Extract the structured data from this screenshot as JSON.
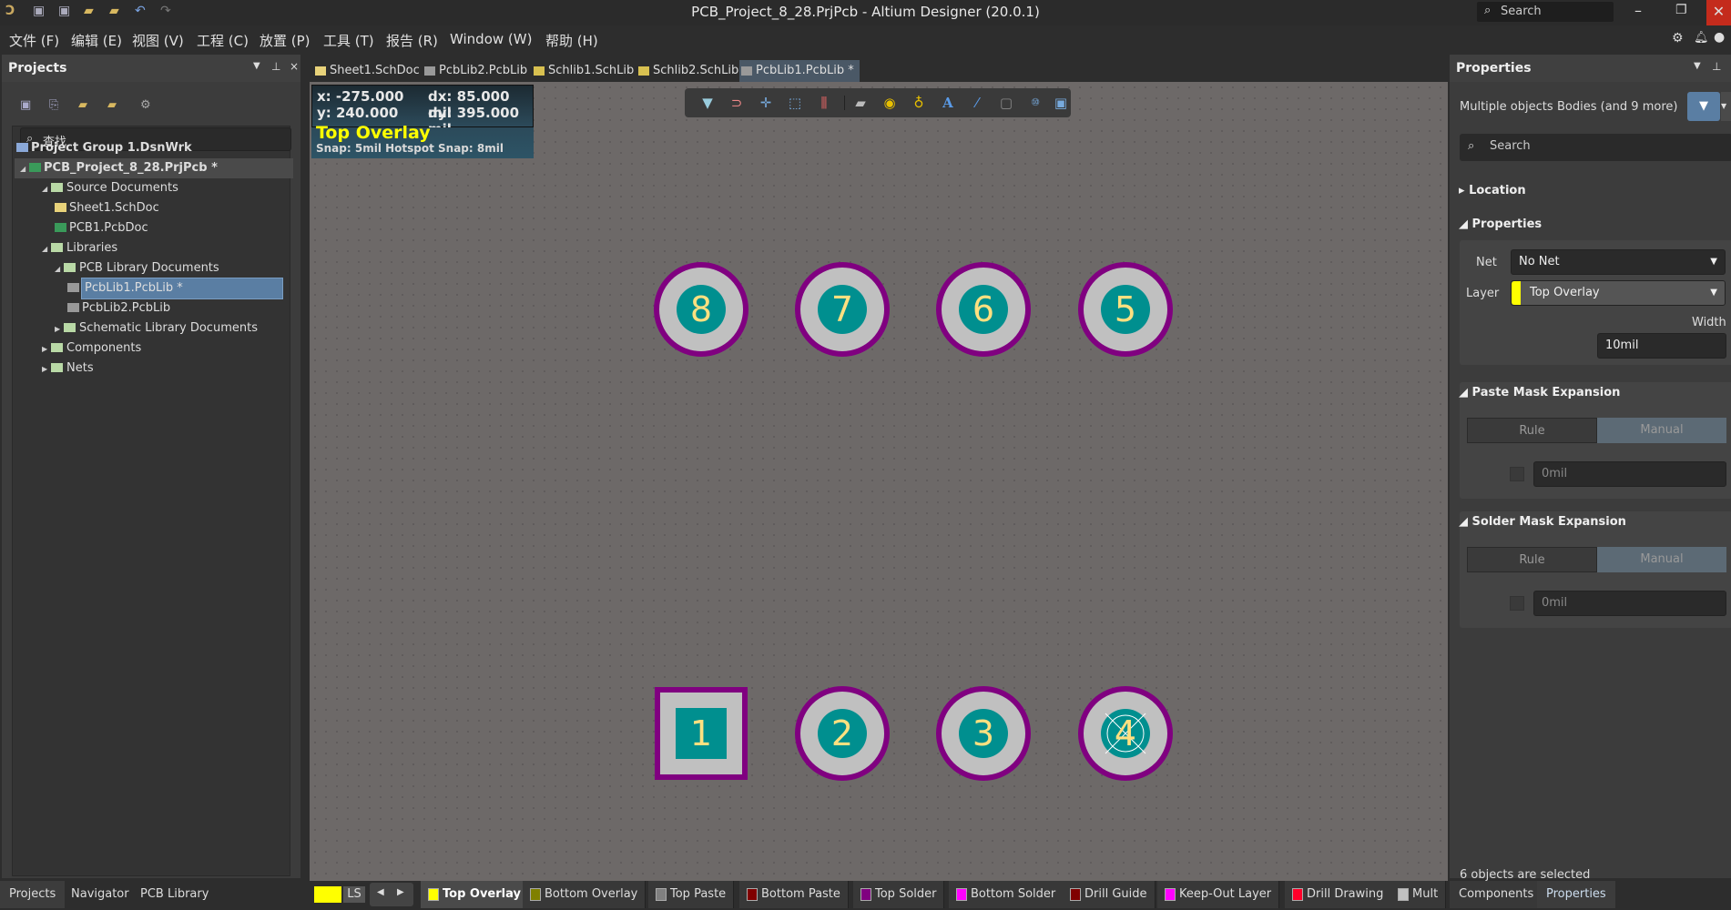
{
  "window": {
    "title": "PCB_Project_8_28.PrjPcb - Altium Designer (20.0.1)",
    "search_placeholder": "Search"
  },
  "menu": [
    "文件 (F)",
    "编辑 (E)",
    "视图 (V)",
    "工程 (C)",
    "放置 (P)",
    "工具 (T)",
    "报告 (R)",
    "Window (W)",
    "帮助 (H)"
  ],
  "projects_panel": {
    "title": "Projects",
    "search_placeholder": "查找",
    "tree": [
      {
        "label": "Project Group 1.DsnWrk",
        "level": 0,
        "bold": true
      },
      {
        "label": "PCB_Project_8_28.PrjPcb *",
        "level": 0,
        "bold": true
      },
      {
        "label": "Source Documents",
        "level": 1
      },
      {
        "label": "Sheet1.SchDoc",
        "level": 2
      },
      {
        "label": "PCB1.PcbDoc",
        "level": 2
      },
      {
        "label": "Libraries",
        "level": 1
      },
      {
        "label": "PCB Library Documents",
        "level": 2
      },
      {
        "label": "PcbLib1.PcbLib *",
        "level": 3,
        "selected": true
      },
      {
        "label": "PcbLib2.PcbLib",
        "level": 3
      },
      {
        "label": "Schematic Library Documents",
        "level": 2
      },
      {
        "label": "Components",
        "level": 1
      },
      {
        "label": "Nets",
        "level": 1
      }
    ],
    "bottom_tabs": [
      "Projects",
      "Navigator",
      "PCB Library"
    ]
  },
  "doc_tabs": [
    "Sheet1.SchDoc",
    "PcbLib2.PcbLib",
    "Schlib1.SchLib",
    "Schlib2.SchLib",
    "PcbLib1.PcbLib *"
  ],
  "hud": {
    "x": "x:  -275.000",
    "dx": "dx:    85.000  mil",
    "y": "y:   240.000",
    "dy": "dy:  395.000 mil",
    "layer": "Top Overlay",
    "snap": "Snap: 5mil Hotspot Snap: 8mil"
  },
  "toolbar_icons": [
    "filter-icon",
    "magnet-icon",
    "crosshair-icon",
    "select-rect-icon",
    "align-icon",
    "component-icon",
    "pad-icon",
    "via-icon",
    "text-icon",
    "line-icon",
    "dimension-icon",
    "region-icon",
    "room-icon"
  ],
  "pads": {
    "top": [
      "8",
      "7",
      "6",
      "5"
    ],
    "bottom": [
      "1",
      "2",
      "3",
      "4"
    ]
  },
  "colors": {
    "pad_copper": "#008f8f",
    "pad_mask": "#c0c0c0",
    "solder_mask": "#800080",
    "number": "#ffe080",
    "canvas": "#6d6968",
    "accent": "#5a7ea3"
  },
  "properties_panel": {
    "title": "Properties",
    "selection": "Multiple objects",
    "filter_text": "Bodies (and 9 more)",
    "search_placeholder": "Search",
    "location": "Location",
    "properties": "Properties",
    "net_label": "Net",
    "net_value": "No Net",
    "layer_label": "Layer",
    "layer_value": "Top Overlay",
    "width_label": "Width",
    "width_value": "10mil",
    "paste_mask": "Paste Mask Expansion",
    "solder_mask": "Solder Mask Expansion",
    "rule": "Rule",
    "manual": "Manual",
    "paste_value": "0mil",
    "solder_value": "0mil",
    "status": "6 objects are selected",
    "bottom_tabs": [
      "Components",
      "Properties"
    ]
  },
  "layer_bar": {
    "current": "LS",
    "layers": [
      {
        "name": "Top Overlay",
        "color": "#ffff00"
      },
      {
        "name": "Bottom Overlay",
        "color": "#808000"
      },
      {
        "name": "Top Paste",
        "color": "#808080"
      },
      {
        "name": "Bottom Paste",
        "color": "#800000"
      },
      {
        "name": "Top Solder",
        "color": "#800080"
      },
      {
        "name": "Bottom Solder",
        "color": "#ff00ff"
      },
      {
        "name": "Drill Guide",
        "color": "#800000"
      },
      {
        "name": "Keep-Out Layer",
        "color": "#ff00ff"
      },
      {
        "name": "Drill Drawing",
        "color": "#ff002a"
      },
      {
        "name": "Mult",
        "color": "#c0c0c0"
      }
    ]
  }
}
